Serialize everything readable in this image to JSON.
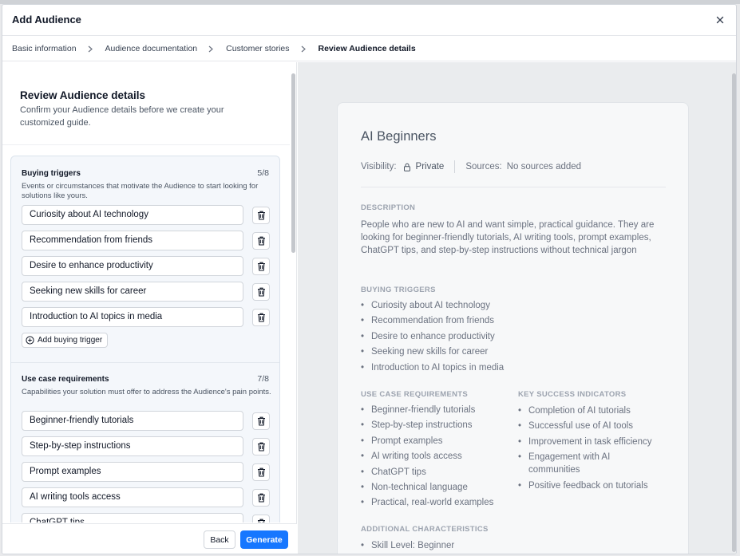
{
  "modal": {
    "title": "Add Audience"
  },
  "steps": [
    "Basic information",
    "Audience documentation",
    "Customer stories",
    "Review Audience details"
  ],
  "left": {
    "title": "Review Audience details",
    "subtitle": "Confirm your Audience details before we create your customized guide.",
    "buying_triggers": {
      "heading": "Buying triggers",
      "count": "5/8",
      "description": "Events or circumstances that motivate the Audience to start looking for solutions like yours.",
      "items": [
        "Curiosity about AI technology",
        "Recommendation from friends",
        "Desire to enhance productivity",
        "Seeking new skills for career",
        "Introduction to AI topics in media"
      ],
      "add_label": "Add buying trigger"
    },
    "use_case": {
      "heading": "Use case requirements",
      "count": "7/8",
      "description": "Capabilities your solution must offer to address the Audience's pain points.",
      "items": [
        "Beginner-friendly tutorials",
        "Step-by-step instructions",
        "Prompt examples",
        "AI writing tools access",
        "ChatGPT tips"
      ]
    },
    "back_label": "Back",
    "generate_label": "Generate"
  },
  "preview": {
    "name": "AI Beginners",
    "visibility_label": "Visibility:",
    "visibility_value": "Private",
    "sources_label": "Sources:",
    "sources_value": "No sources added",
    "description_label": "DESCRIPTION",
    "description": "People who are new to AI and want simple, practical guidance. They are looking for beginner-friendly tutorials, AI writing tools, prompt examples, ChatGPT tips, and step-by-step instructions without technical jargon",
    "buying_triggers_label": "BUYING TRIGGERS",
    "buying_triggers": [
      "Curiosity about AI technology",
      "Recommendation from friends",
      "Desire to enhance productivity",
      "Seeking new skills for career",
      "Introduction to AI topics in media"
    ],
    "use_case_label": "USE CASE REQUIREMENTS",
    "use_case": [
      "Beginner-friendly tutorials",
      "Step-by-step instructions",
      "Prompt examples",
      "AI writing tools access",
      "ChatGPT tips",
      "Non-technical language",
      "Practical, real-world examples"
    ],
    "ksi_label": "KEY SUCCESS INDICATORS",
    "ksi": [
      "Completion of AI tutorials",
      "Successful use of AI tools",
      "Improvement in task efficiency",
      "Engagement with AI communities",
      "Positive feedback on tutorials"
    ],
    "additional_label": "ADDITIONAL CHARACTERISTICS",
    "additional": [
      "Skill Level: Beginner"
    ]
  }
}
